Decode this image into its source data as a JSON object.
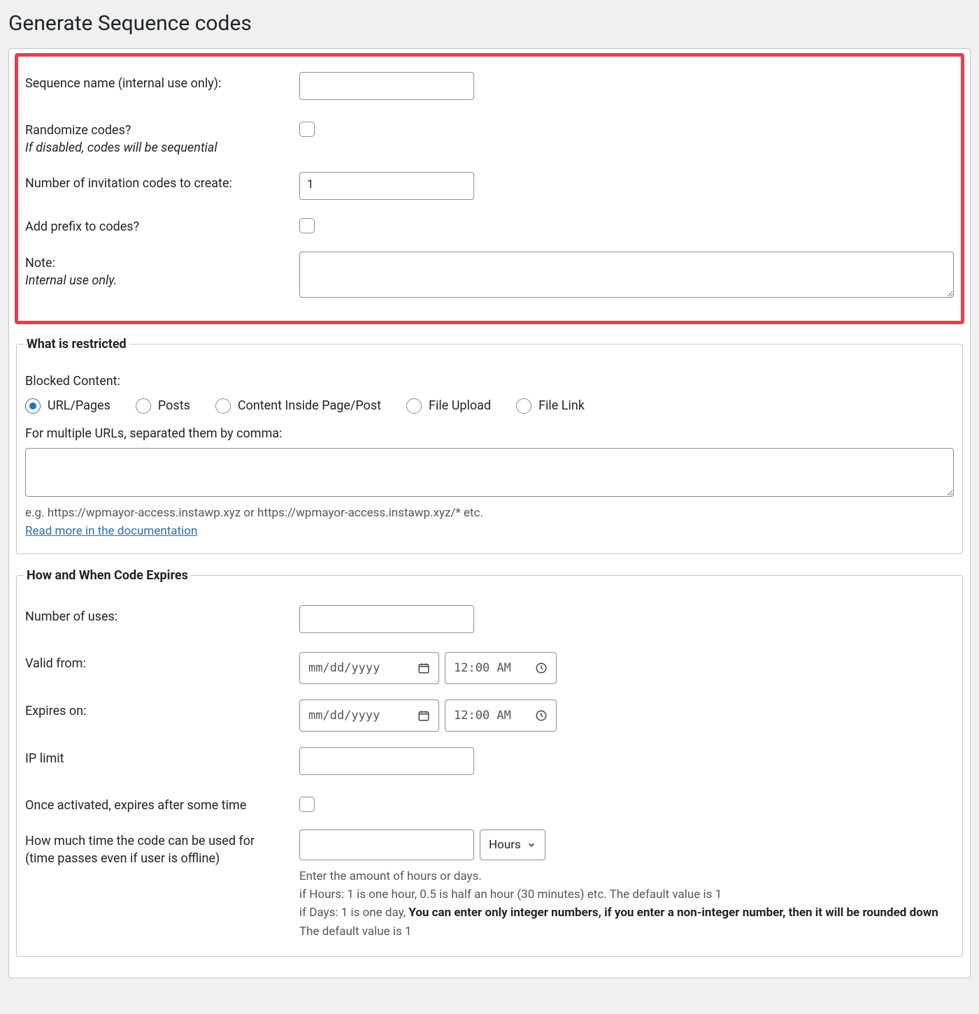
{
  "page": {
    "title": "Generate Sequence codes"
  },
  "seq": {
    "name_label": "Sequence name (internal use only):",
    "name_value": "",
    "randomize_label": "Randomize codes?",
    "randomize_hint": "If disabled, codes will be sequential",
    "count_label": "Number of invitation codes to create:",
    "count_value": "1",
    "prefix_label": "Add prefix to codes?",
    "note_label": "Note:",
    "note_hint": "Internal use only.",
    "note_value": ""
  },
  "restricted": {
    "legend": "What is restricted",
    "blocked_label": "Blocked Content:",
    "options": {
      "url": "URL/Pages",
      "posts": "Posts",
      "inside": "Content Inside Page/Post",
      "upload": "File Upload",
      "link": "File Link"
    },
    "urls_label": "For multiple URLs, separated them by comma:",
    "urls_value": "",
    "urls_hint": "e.g. https://wpmayor-access.instawp.xyz or https://wpmayor-access.instawp.xyz/* etc.",
    "doc_link": "Read more in the documentation"
  },
  "expires": {
    "legend": "How and When Code Expires",
    "uses_label": "Number of uses:",
    "uses_value": "",
    "valid_from_label": "Valid from:",
    "date_placeholder": "mm/dd/yyyy",
    "time_placeholder": "12:00 AM",
    "expires_on_label": "Expires on:",
    "ip_limit_label": "IP limit",
    "ip_limit_value": "",
    "once_activated_label": "Once activated, expires after some time",
    "duration_label_1": "How much time the code can be used for",
    "duration_label_2": "(time passes even if user is offline)",
    "duration_value": "",
    "duration_unit": "Hours",
    "desc_line1": "Enter the amount of hours or days.",
    "desc_line2": "if Hours: 1 is one hour, 0.5 is half an hour (30 minutes) etc. The default value is 1",
    "desc_line3_a": "if Days: 1 is one day, ",
    "desc_line3_b": "You can enter only integer numbers, if you enter a non-integer number, then it will be rounded down",
    "desc_line3_c": " The default value is 1"
  }
}
